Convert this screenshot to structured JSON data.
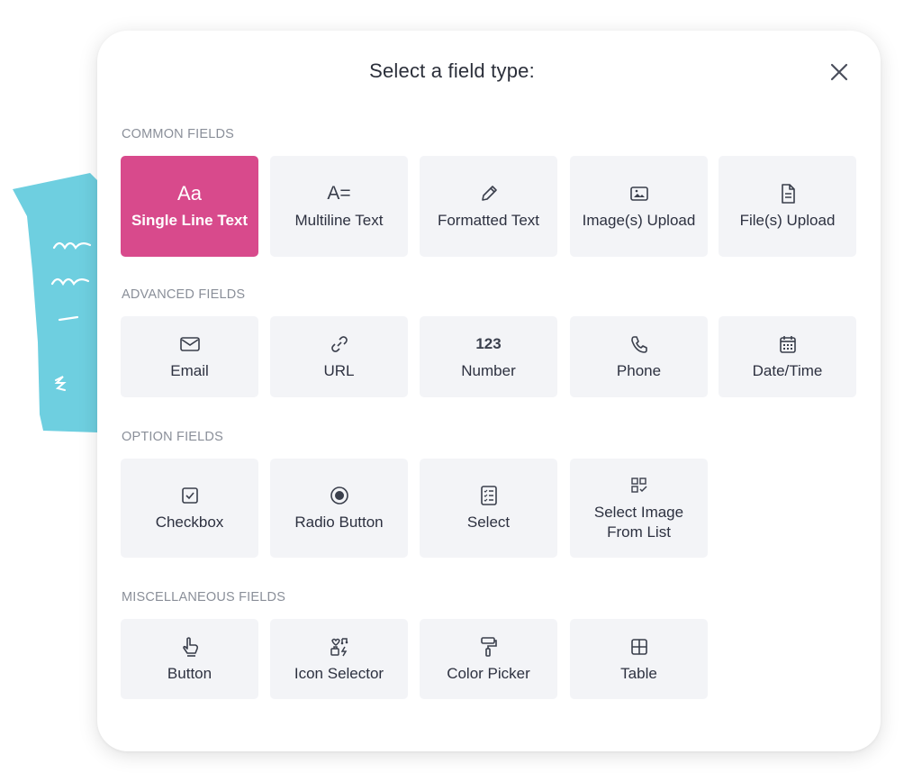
{
  "modal": {
    "title": "Select a field type:"
  },
  "sections": {
    "common": {
      "title": "COMMON FIELDS",
      "items": [
        {
          "label": "Single Line Text",
          "icon": "text-aa-icon",
          "icon_text": "Aa",
          "selected": true
        },
        {
          "label": "Multiline Text",
          "icon": "text-lines-icon",
          "icon_text": "A="
        },
        {
          "label": "Formatted Text",
          "icon": "pencil-icon"
        },
        {
          "label": "Image(s) Upload",
          "icon": "image-icon"
        },
        {
          "label": "File(s) Upload",
          "icon": "file-icon"
        }
      ]
    },
    "advanced": {
      "title": "ADVANCED FIELDS",
      "items": [
        {
          "label": "Email",
          "icon": "envelope-icon"
        },
        {
          "label": "URL",
          "icon": "link-icon"
        },
        {
          "label": "Number",
          "icon": "number-icon",
          "icon_text": "123"
        },
        {
          "label": "Phone",
          "icon": "phone-icon"
        },
        {
          "label": "Date/Time",
          "icon": "calendar-icon"
        }
      ]
    },
    "option": {
      "title": "OPTION FIELDS",
      "items": [
        {
          "label": "Checkbox",
          "icon": "checkbox-icon"
        },
        {
          "label": "Radio Button",
          "icon": "radio-icon"
        },
        {
          "label": "Select",
          "icon": "list-icon"
        },
        {
          "label": "Select Image From List",
          "icon": "image-grid-icon"
        }
      ]
    },
    "misc": {
      "title": "MISCELLANEOUS FIELDS",
      "items": [
        {
          "label": "Button",
          "icon": "pointer-hand-icon"
        },
        {
          "label": "Icon Selector",
          "icon": "icon-selector-icon"
        },
        {
          "label": "Color Picker",
          "icon": "paint-roller-icon"
        },
        {
          "label": "Table",
          "icon": "table-icon"
        }
      ]
    }
  },
  "colors": {
    "accent": "#d84a8c",
    "tile_bg": "#f3f4f7",
    "decoration": "#6ecfe0"
  }
}
